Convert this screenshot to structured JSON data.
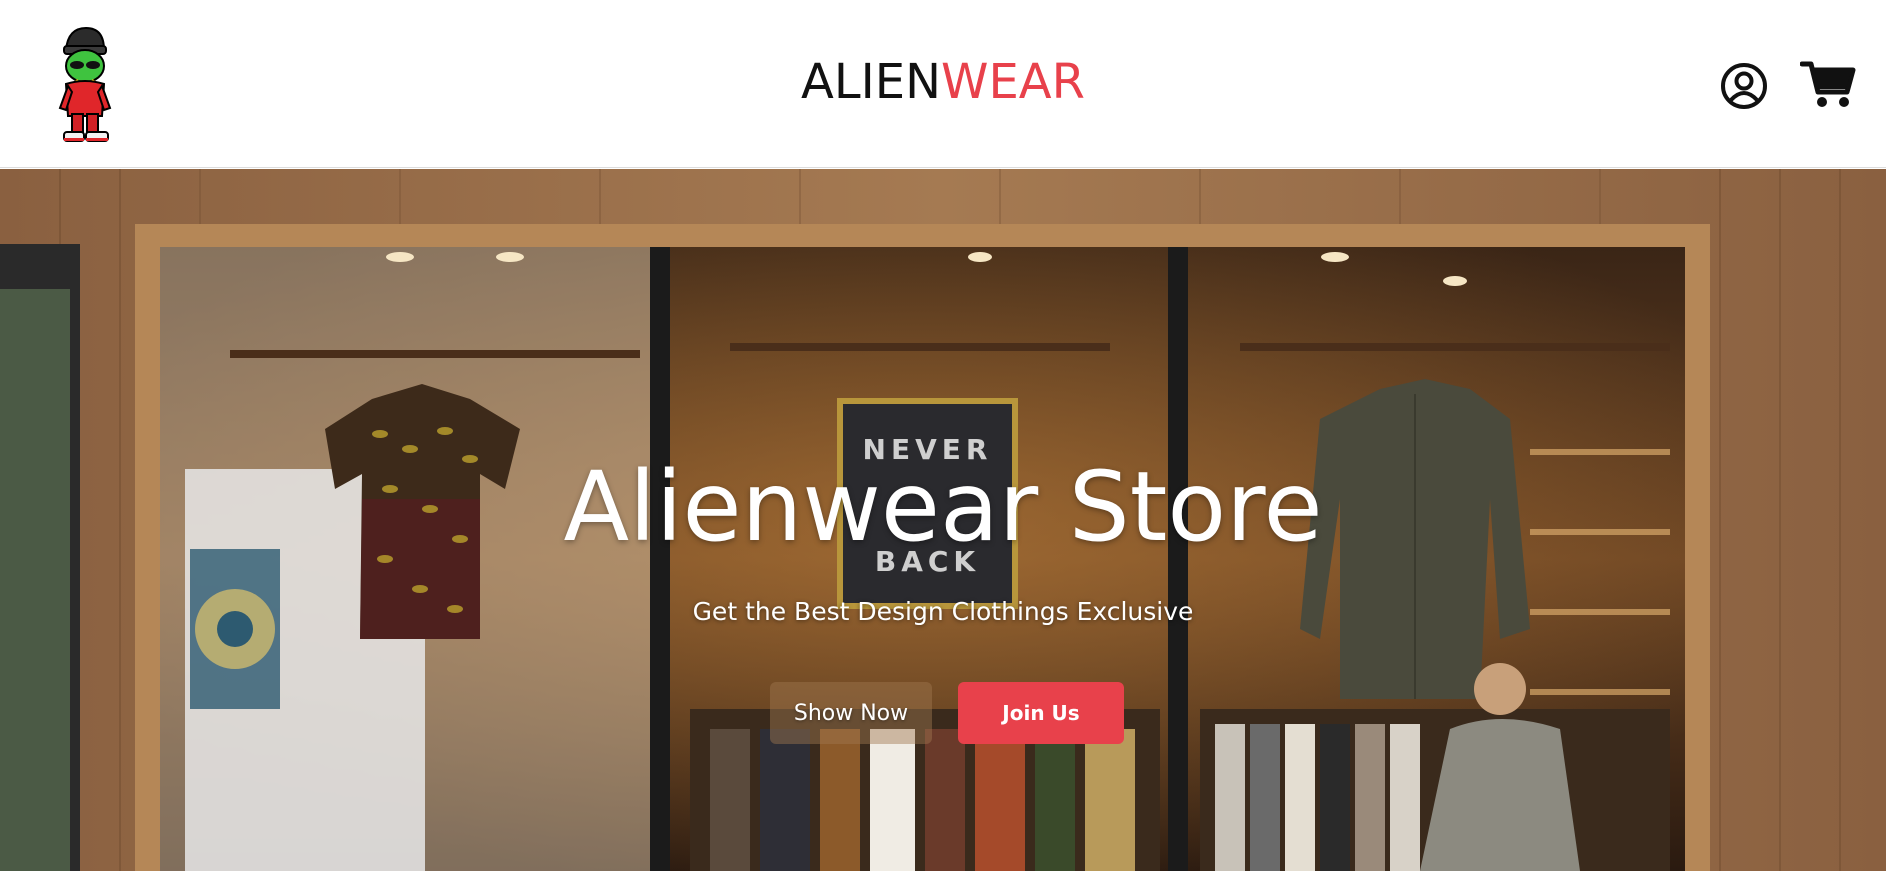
{
  "header": {
    "logo_icon": "alien-mascot-logo",
    "brand_part1": "ALIEN",
    "brand_part2": "WEAR",
    "user_icon": "user-circle-icon",
    "cart_icon": "shopping-cart-icon"
  },
  "hero": {
    "title": "Alienwear Store",
    "subtitle": "Get the Best Design Clothings Exclusive",
    "show_button_label": "Show Now",
    "join_button_label": "Join Us",
    "store_sign_line1": "NEVER",
    "store_sign_line2": "BACK"
  },
  "colors": {
    "accent": "#e8414b",
    "text_dark": "#111111",
    "white": "#ffffff"
  }
}
